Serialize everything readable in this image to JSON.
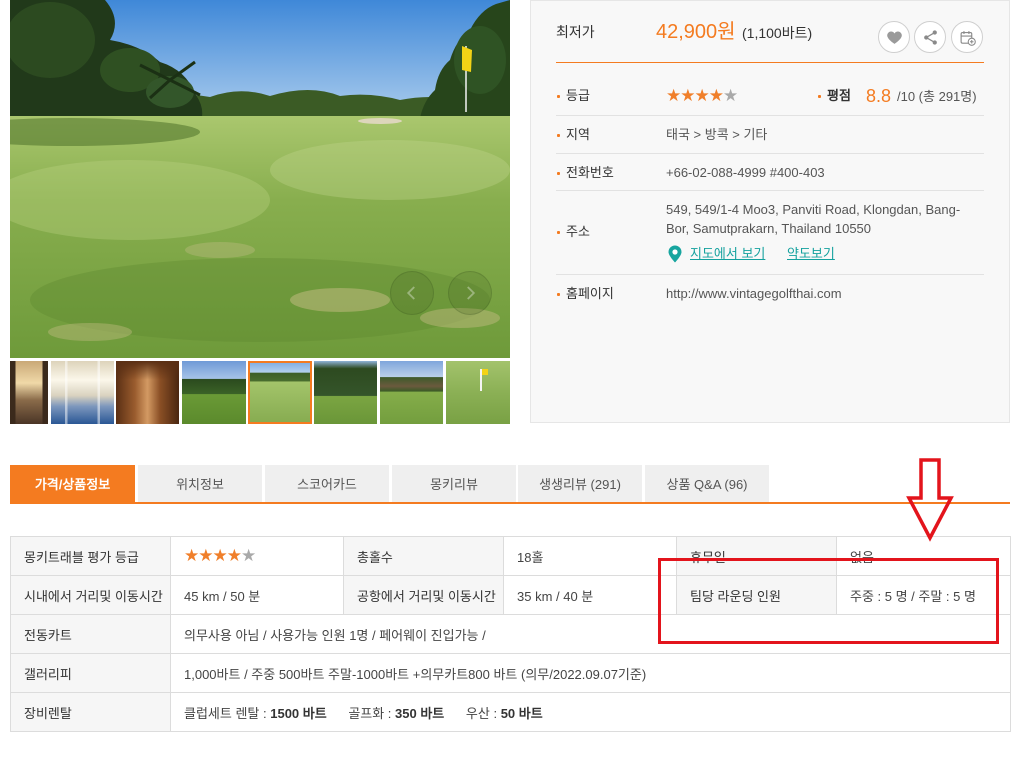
{
  "colors": {
    "accent": "#f47b20",
    "link": "#14a19e",
    "star_filled": "#f07f2a",
    "star_empty": "#a9a9a9",
    "annotation": "#e3141c"
  },
  "gallery": {
    "prev_icon": "chevron-left-icon",
    "next_icon": "chevron-right-icon",
    "selected_thumbnail": 5
  },
  "summary": {
    "price_label": "최저가",
    "price": "42,900원",
    "price_sub": "(1,100바트)",
    "actions": {
      "wishlist_icon": "heart-icon",
      "share_icon": "share-icon",
      "calendar_icon": "calendar-add-icon"
    },
    "grade": {
      "label": "등급",
      "stars": 4,
      "max_stars": 5
    },
    "rating": {
      "label": "평점",
      "value": "8.8",
      "suffix": "/10 (총 291명)"
    },
    "region": {
      "label": "지역",
      "value": "태국 > 방콕 > 기타"
    },
    "phone": {
      "label": "전화번호",
      "value": "+66-02-088-4999 #400-403"
    },
    "address": {
      "label": "주소",
      "lines": [
        "549, 549/1-4 Moo3, Panviti Road, Klongdan, Bang-",
        "Bor, Samutprakarn, Thailand 10550"
      ],
      "map_icon": "map-pin-icon",
      "map_link": "지도에서 보기",
      "sketch_link": "약도보기"
    },
    "homepage": {
      "label": "홈페이지",
      "value": "http://www.vintagegolfthai.com"
    }
  },
  "tabs": {
    "items": [
      "가격/상품정보",
      "위치정보",
      "스코어카드",
      "몽키리뷰",
      "생생리뷰 (291)",
      "상품 Q&A (96)"
    ],
    "active": 0
  },
  "info_table": {
    "grade": {
      "label": "몽키트래블 평가 등급",
      "stars": 4,
      "max_stars": 5
    },
    "holes": {
      "label": "총홀수",
      "value": "18홀"
    },
    "closed_days": {
      "label": "휴무일",
      "value": "없음"
    },
    "city_distance": {
      "label": "시내에서 거리및 이동시간",
      "value": "45 km / 50 분"
    },
    "airport_distance": {
      "label": "공항에서 거리및 이동시간",
      "value": "35 km / 40 분"
    },
    "players": {
      "label": "팀당 라운딩 인원",
      "value": "주중 : 5 명 / 주말 : 5 명"
    },
    "cart": {
      "label": "전동카트",
      "value": "의무사용 아님 / 사용가능 인원 1명 / 페어웨이 진입가능 /"
    },
    "gallery_fee": {
      "label": "갤러리피",
      "value": "1,000바트 / 주중 500바트 주말-1000바트 +의무카트800 바트 (의무/2022.09.07기준)"
    },
    "rental": {
      "label": "장비렌탈",
      "items": [
        {
          "name": "클럽세트 렌탈 :",
          "price": "1500 바트"
        },
        {
          "name": "골프화 :",
          "price": "350 바트"
        },
        {
          "name": "우산 :",
          "price": "50 바트"
        }
      ]
    }
  }
}
